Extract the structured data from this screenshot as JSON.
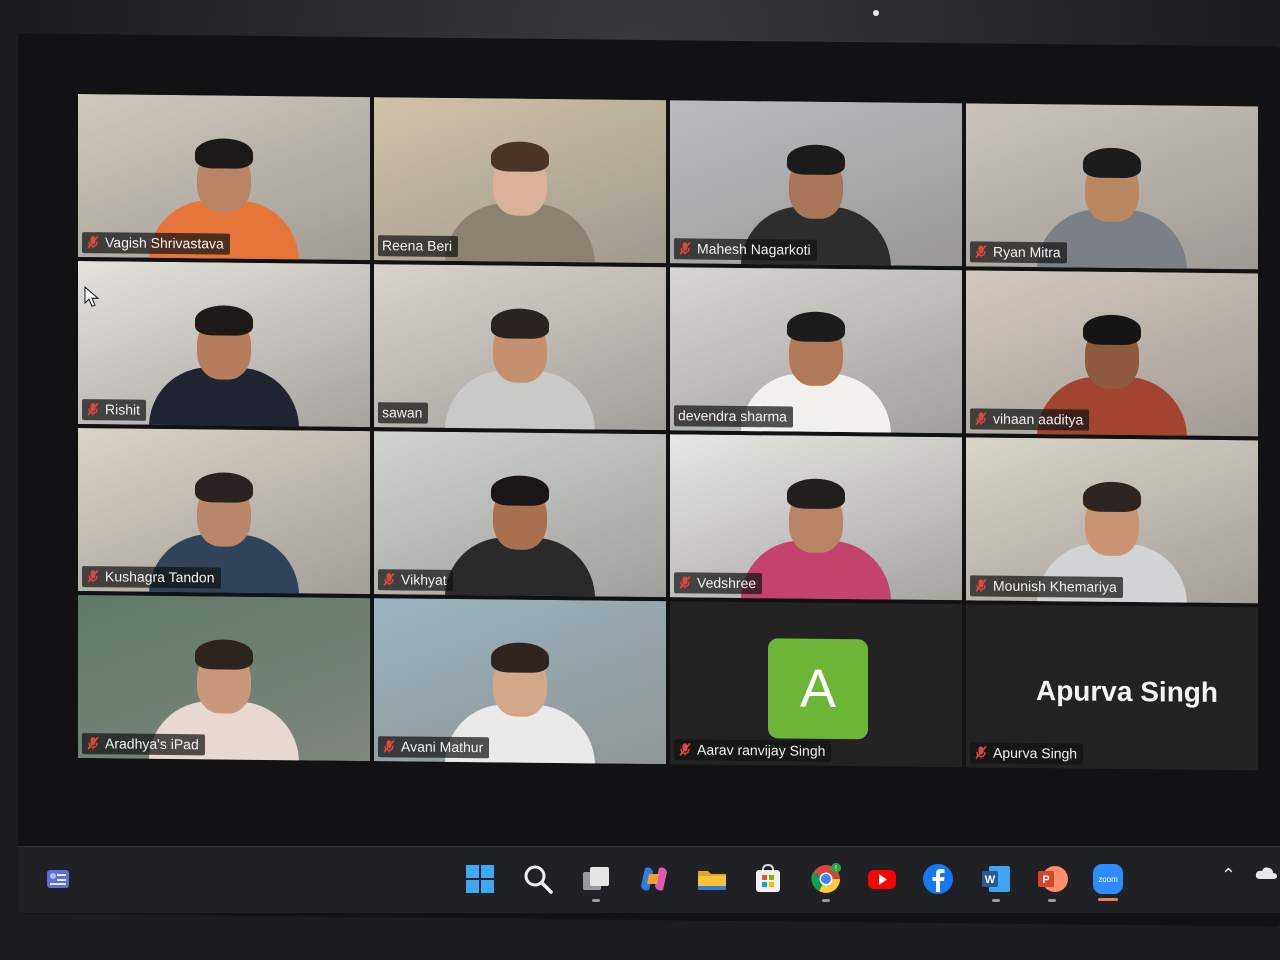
{
  "participants": [
    {
      "name": "Vagish Shrivastava",
      "muted": true,
      "speaking": false,
      "bg": "#cfc8bd",
      "skin": "#b88463",
      "hair": "#1c1a19",
      "shirt": "#e57538"
    },
    {
      "name": "Reena Beri",
      "muted": false,
      "speaking": false,
      "bg": "#cfc3a6",
      "skin": "#d9b299",
      "hair": "#4a3426",
      "shirt": "#8c8272"
    },
    {
      "name": "Mahesh Nagarkoti",
      "muted": true,
      "speaking": false,
      "bg": "#b9bcbf",
      "skin": "#a8755a",
      "hair": "#1b1b1b",
      "shirt": "#2d2d2d"
    },
    {
      "name": "Ryan Mitra",
      "muted": true,
      "speaking": false,
      "bg": "#c9c3bb",
      "skin": "#b88862",
      "hair": "#1c1c1c",
      "shirt": "#7b7f86"
    },
    {
      "name": "Rishit",
      "muted": true,
      "speaking": false,
      "bg": "#e4e2dc",
      "skin": "#b57d5c",
      "hair": "#1f1a17",
      "shirt": "#1f2430"
    },
    {
      "name": "sawan",
      "muted": false,
      "speaking": false,
      "bg": "#d8d3cc",
      "skin": "#c49170",
      "hair": "#2a2320",
      "shirt": "#c9c9c7"
    },
    {
      "name": "devendra sharma",
      "muted": false,
      "speaking": true,
      "bg": "#d6d5d2",
      "skin": "#b07a5a",
      "hair": "#1c1c1c",
      "shirt": "#f1f0ec"
    },
    {
      "name": "vihaan aaditya",
      "muted": true,
      "speaking": false,
      "bg": "#d3c8bd",
      "skin": "#8d5a3e",
      "hair": "#151515",
      "shirt": "#a34431"
    },
    {
      "name": "Kushagra Tandon",
      "muted": true,
      "speaking": false,
      "bg": "#d9d2c7",
      "skin": "#b8876a",
      "hair": "#2a2220",
      "shirt": "#31435a"
    },
    {
      "name": "Vikhyat",
      "muted": true,
      "speaking": false,
      "bg": "#cfd3cf",
      "skin": "#a9704f",
      "hair": "#1b1615",
      "shirt": "#2a2a2a"
    },
    {
      "name": "Vedshree",
      "muted": true,
      "speaking": false,
      "bg": "#e6e6e2",
      "skin": "#b98466",
      "hair": "#231d1c",
      "shirt": "#c3436c"
    },
    {
      "name": "Mounish Khemariya",
      "muted": true,
      "speaking": false,
      "bg": "#d9d4c8",
      "skin": "#c79474",
      "hair": "#2e2523",
      "shirt": "#d2d3d5"
    },
    {
      "name": "Aradhya's iPad",
      "muted": true,
      "speaking": false,
      "bg": "#5f7a68",
      "skin": "#c9977b",
      "hair": "#2d231f",
      "shirt": "#e7d9cf"
    },
    {
      "name": "Avani Mathur",
      "muted": true,
      "speaking": false,
      "bg": "#99b3be",
      "skin": "#d3a88a",
      "hair": "#2f241f",
      "shirt": "#eaeaea"
    },
    {
      "name": "Aarav ranvijay Singh",
      "muted": true,
      "speaking": false,
      "avatar_letter": "A"
    },
    {
      "name": "Apurva Singh",
      "muted": true,
      "speaking": false,
      "display_name": "Apurva Singh"
    }
  ],
  "taskbar": {
    "items": [
      {
        "icon": "widgets-icon"
      },
      {
        "icon": "windows-start-icon"
      },
      {
        "icon": "search-icon"
      },
      {
        "icon": "task-view-icon"
      },
      {
        "icon": "copilot-icon"
      },
      {
        "icon": "file-explorer-icon"
      },
      {
        "icon": "microsoft-store-icon"
      },
      {
        "icon": "chrome-icon",
        "badge": "!"
      },
      {
        "icon": "youtube-icon"
      },
      {
        "icon": "facebook-icon"
      },
      {
        "icon": "word-icon"
      },
      {
        "icon": "powerpoint-icon"
      },
      {
        "icon": "zoom-icon",
        "label": "zoom"
      }
    ],
    "colors": {
      "zoom": "#2d8cff",
      "youtube": "#ff0000",
      "facebook": "#1877f2",
      "word": "#2b579a",
      "powerpoint": "#d24726",
      "store": "#f3f3f3",
      "explorer": "#f8c33a",
      "start": "#3fa9f5"
    }
  }
}
